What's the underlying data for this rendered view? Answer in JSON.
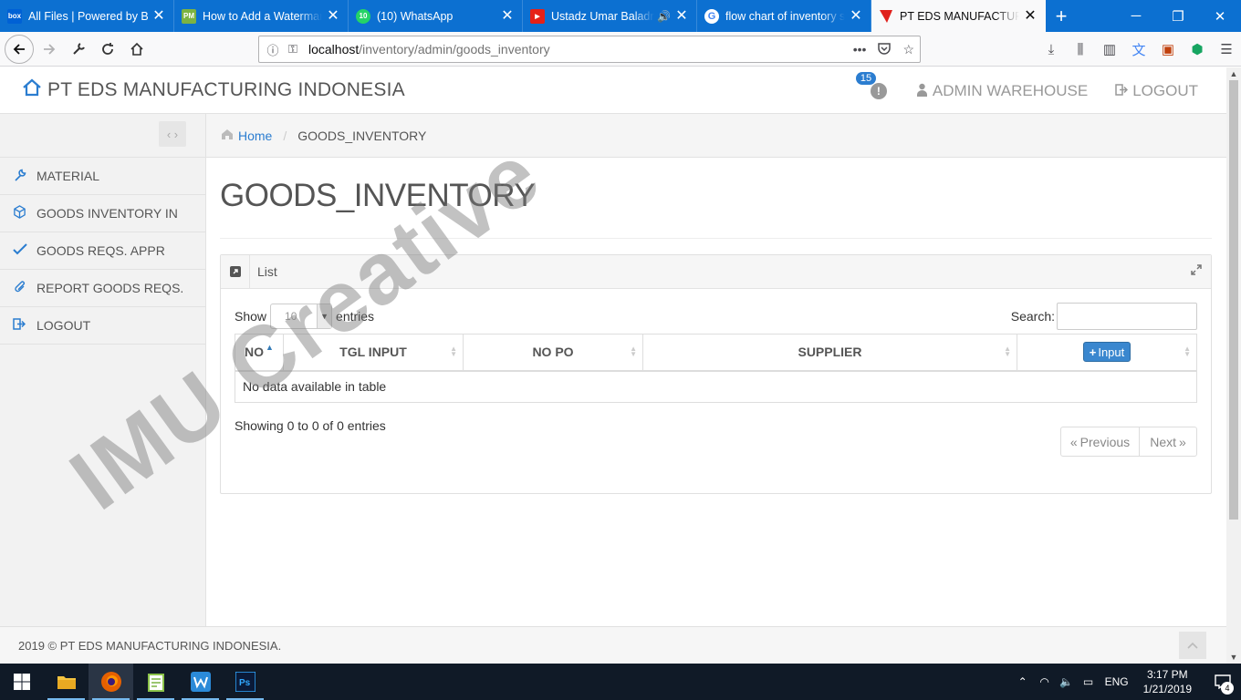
{
  "browser": {
    "tabs": [
      {
        "title": "All Files | Powered by Box",
        "favicon": "box-icon",
        "favicon_text": "box",
        "active": false
      },
      {
        "title": "How to Add a Watermar",
        "favicon": "pm-icon",
        "favicon_text": "PM",
        "active": false
      },
      {
        "title": "(10) WhatsApp",
        "favicon": "whatsapp-icon",
        "favicon_text": "10",
        "active": false
      },
      {
        "title": "Ustadz Umar Baladraf",
        "favicon": "youtube-icon",
        "favicon_text": "",
        "active": false,
        "audio": true
      },
      {
        "title": "flow chart of inventory s",
        "favicon": "google-icon",
        "favicon_text": "G",
        "active": false
      },
      {
        "title": "PT EDS MANUFACTURIN",
        "favicon": "flag-icon",
        "favicon_text": "",
        "active": true
      }
    ],
    "url_host": "localhost",
    "url_path": "/inventory/admin/goods_inventory"
  },
  "app": {
    "brand": "PT EDS MANUFACTURING INDONESIA",
    "notification_count": "15",
    "notification_symbol": "!",
    "user": "ADMIN WAREHOUSE",
    "logout": "LOGOUT"
  },
  "sidebar": {
    "toggle_label": "‹ ›",
    "items": [
      {
        "label": "MATERIAL",
        "icon": "wrench-icon"
      },
      {
        "label": "GOODS INVENTORY IN",
        "icon": "cube-icon"
      },
      {
        "label": "GOODS REQS. APPR",
        "icon": "check-icon"
      },
      {
        "label": "REPORT GOODS REQS.",
        "icon": "paperclip-icon"
      },
      {
        "label": "LOGOUT",
        "icon": "sign-out-icon"
      }
    ]
  },
  "breadcrumb": {
    "home": "Home",
    "current": "GOODS_INVENTORY"
  },
  "page": {
    "title": "GOODS_INVENTORY",
    "box_title": "List",
    "show_label": "Show",
    "entries_value": "10",
    "entries_label": "entries",
    "search_label": "Search:",
    "search_value": "",
    "columns": [
      "NO",
      "TGL INPUT",
      "NO PO",
      "SUPPLIER"
    ],
    "input_button": "Input",
    "empty_message": "No data available in table",
    "info": "Showing 0 to 0 of 0 entries",
    "prev": "Previous",
    "next": "Next"
  },
  "footer": {
    "text": "2019 © PT EDS MANUFACTURING INDONESIA."
  },
  "watermark": "IMU Creative",
  "taskbar": {
    "apps": [
      "file-explorer-icon",
      "firefox-icon",
      "notepad-plus-icon",
      "wps-writer-icon",
      "photoshop-icon"
    ],
    "language": "ENG",
    "time": "3:17 PM",
    "date": "1/21/2019",
    "notification_count": "4"
  },
  "colors": {
    "accent": "#2b7dd0",
    "browser_blue": "#0c70d1",
    "taskbar": "#101a27"
  }
}
